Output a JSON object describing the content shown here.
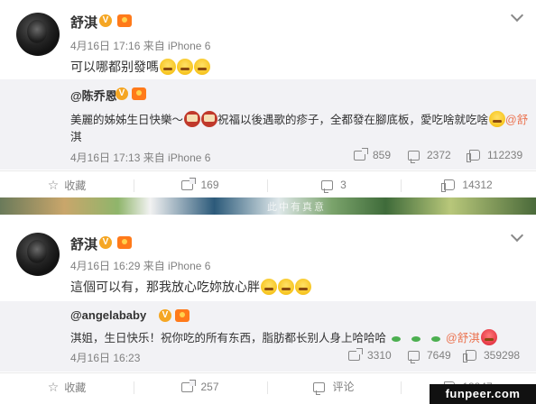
{
  "post1": {
    "username": "舒淇",
    "meta": "4月16日 17:16 来自 iPhone 6",
    "text": "可以哪都别發嗎",
    "repost": {
      "user": "@陈乔恩",
      "text_line1": "美麗的姊姊生日快樂～",
      "text_line1b": "祝福以後遇歌的疹子，全都發在腳底板，愛吃啥就吃啥",
      "mention": "@舒",
      "text_line2": "淇",
      "meta": "4月16日 17:13 来自 iPhone 6",
      "shares": "859",
      "comments": "2372",
      "likes": "112239"
    },
    "actions": {
      "favorite": "收藏",
      "shares": "169",
      "comments": "3",
      "likes": "14312"
    }
  },
  "divider_text": "此中有真意",
  "post2": {
    "username": "舒淇",
    "meta": "4月16日 16:29 来自 iPhone 6",
    "text": "這個可以有，那我放心吃妳放心胖",
    "repost": {
      "user": "@angelababy",
      "text": "淇姐，生日快乐！祝你吃的所有东西，脂肪都长别人身上哈哈哈",
      "mention": "@舒淇",
      "meta": "4月16日 16:23",
      "shares": "3310",
      "comments": "7649",
      "likes": "359298"
    },
    "actions": {
      "favorite": "收藏",
      "shares": "257",
      "comment_label": "评论",
      "likes": "18847"
    }
  },
  "watermark": "funpeer.com",
  "colors": {
    "accent": "#eb7350",
    "badge": "#f5a623",
    "repost_bg": "#f2f2f5",
    "meta": "#808080"
  }
}
